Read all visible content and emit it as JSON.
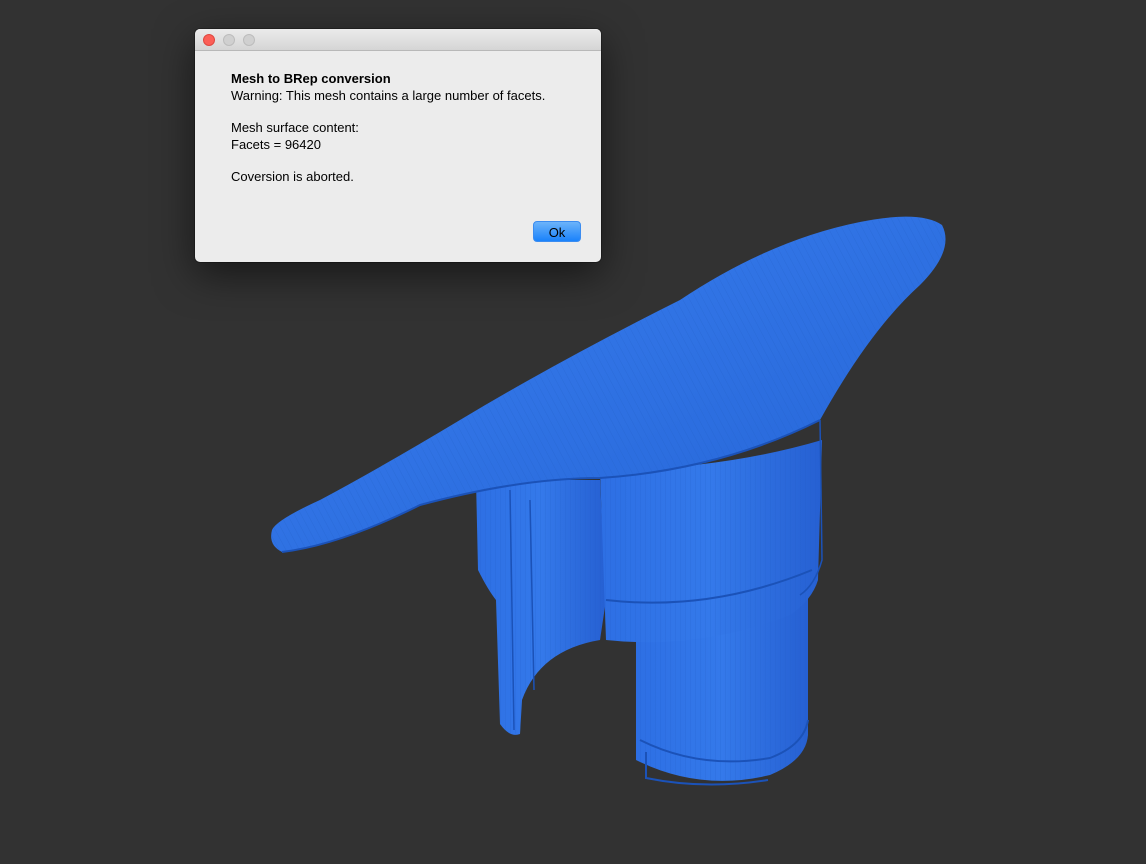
{
  "viewport": {
    "background_color": "#323232",
    "model_color": "#2a6fe0"
  },
  "dialog": {
    "title": "Mesh to BRep conversion",
    "warning": "Warning: This mesh contains a large number of facets.",
    "content_heading": "Mesh surface content:",
    "facets_line": "Facets = 96420",
    "status": "Coversion is aborted.",
    "ok_label": "Ok"
  }
}
